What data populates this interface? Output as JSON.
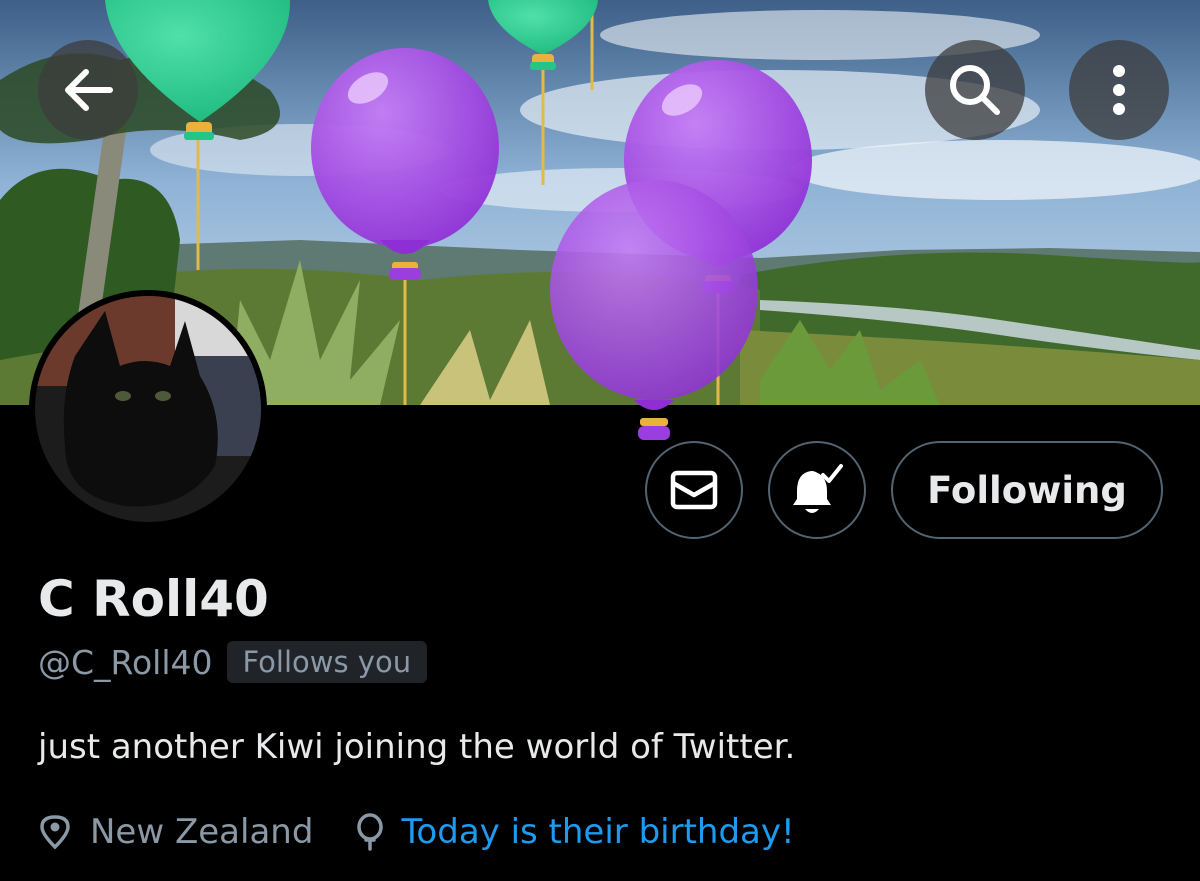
{
  "profile": {
    "display_name": "C Roll40",
    "handle": "@C_Roll40",
    "follows_you_badge": "Follows you",
    "bio": "just another Kiwi joining the world of Twitter.",
    "location": "New Zealand",
    "birthday_text": "Today is their birthday!"
  },
  "actions": {
    "following_label": "Following"
  },
  "icons": {
    "back": "arrow-left-icon",
    "search": "search-icon",
    "more": "more-vertical-icon",
    "message": "envelope-icon",
    "notifications": "bell-check-icon",
    "location": "location-pin-icon",
    "birthday": "balloon-icon"
  },
  "colors": {
    "link": "#1d9bf0",
    "balloon_purple": "#a24be0",
    "balloon_green": "#2fcf92"
  }
}
